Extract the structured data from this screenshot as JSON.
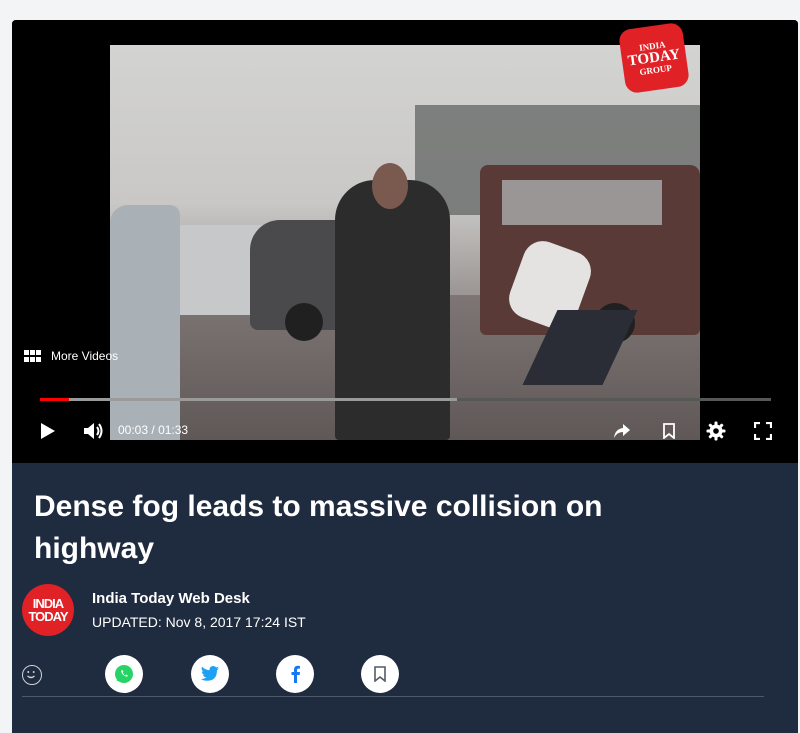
{
  "video": {
    "more_videos_label": "More Videos",
    "current_time": "00:03",
    "separator": "/",
    "duration": "01:33",
    "played_fraction": 0.04,
    "buffered_fraction": 0.57,
    "logo": {
      "line1": "INDIA",
      "line2": "TODAY",
      "line3": "GROUP"
    }
  },
  "article": {
    "headline": "Dense fog leads to massive collision on highway",
    "author": "India Today Web Desk",
    "updated": "UPDATED: Nov 8, 2017 17:24 IST",
    "avatar": {
      "line1": "INDIA",
      "line2": "TODAY"
    }
  },
  "colors": {
    "brand_red": "#e02126",
    "card_bg": "#1f2b3f",
    "whatsapp": "#25d366",
    "twitter": "#1da1f2",
    "facebook": "#1877f2"
  },
  "icons": {
    "play": "play-icon",
    "volume": "volume-icon",
    "share": "share-arrow-icon",
    "bookmark": "bookmark-icon",
    "settings": "gear-icon",
    "fullscreen": "fullscreen-icon",
    "emoji": "smiley-icon",
    "whatsapp": "whatsapp-icon",
    "twitter": "twitter-icon",
    "facebook": "facebook-icon"
  }
}
